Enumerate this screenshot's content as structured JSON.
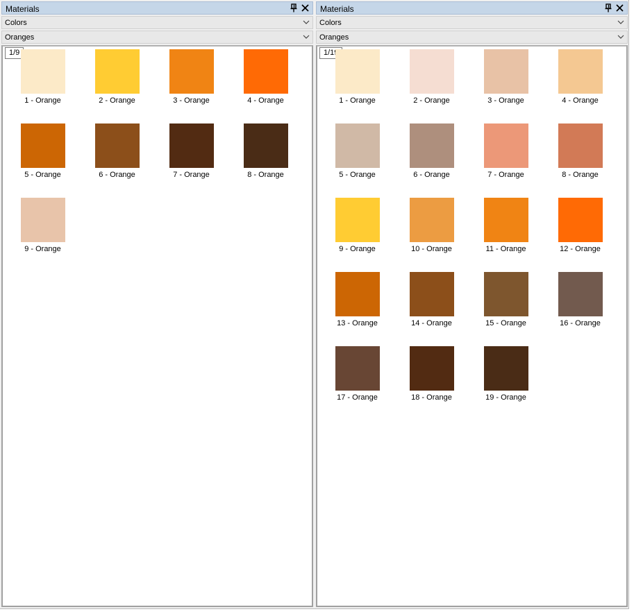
{
  "panels": [
    {
      "title": "Materials",
      "category": "Colors",
      "subcategory": "Oranges",
      "page": "1/9",
      "swatches": [
        {
          "label": "1 - Orange",
          "color": "#fceac8"
        },
        {
          "label": "2 - Orange",
          "color": "#ffcc33"
        },
        {
          "label": "3 - Orange",
          "color": "#f08414"
        },
        {
          "label": "4 - Orange",
          "color": "#ff6a05"
        },
        {
          "label": "5 - Orange",
          "color": "#cc6604"
        },
        {
          "label": "6 - Orange",
          "color": "#8c4f1a"
        },
        {
          "label": "7 - Orange",
          "color": "#522b12"
        },
        {
          "label": "8 - Orange",
          "color": "#4a2c16"
        },
        {
          "label": "9 - Orange",
          "color": "#e8c4aa"
        }
      ]
    },
    {
      "title": "Materials",
      "category": "Colors",
      "subcategory": "Oranges",
      "page": "1/19",
      "swatches": [
        {
          "label": "1 - Orange",
          "color": "#fceac8"
        },
        {
          "label": "2 - Orange",
          "color": "#f5ddd2"
        },
        {
          "label": "3 - Orange",
          "color": "#e8c2a6"
        },
        {
          "label": "4 - Orange",
          "color": "#f4c892"
        },
        {
          "label": "5 - Orange",
          "color": "#d0b9a6"
        },
        {
          "label": "6 - Orange",
          "color": "#ae8f7d"
        },
        {
          "label": "7 - Orange",
          "color": "#ec9878"
        },
        {
          "label": "8 - Orange",
          "color": "#d27a56"
        },
        {
          "label": "9 - Orange",
          "color": "#ffcc33"
        },
        {
          "label": "10 - Orange",
          "color": "#ec9c42"
        },
        {
          "label": "11 - Orange",
          "color": "#f08414"
        },
        {
          "label": "12 - Orange",
          "color": "#ff6a05"
        },
        {
          "label": "13 - Orange",
          "color": "#cc6604"
        },
        {
          "label": "14 - Orange",
          "color": "#8c4f1a"
        },
        {
          "label": "15 - Orange",
          "color": "#7e562e"
        },
        {
          "label": "16 - Orange",
          "color": "#725a4e"
        },
        {
          "label": "17 - Orange",
          "color": "#684634"
        },
        {
          "label": "18 - Orange",
          "color": "#522b12"
        },
        {
          "label": "19 - Orange",
          "color": "#4a2c16"
        }
      ]
    }
  ],
  "icons": {
    "pin": "pin-icon",
    "close": "close-icon",
    "dropdown": "chevron-down-icon"
  }
}
